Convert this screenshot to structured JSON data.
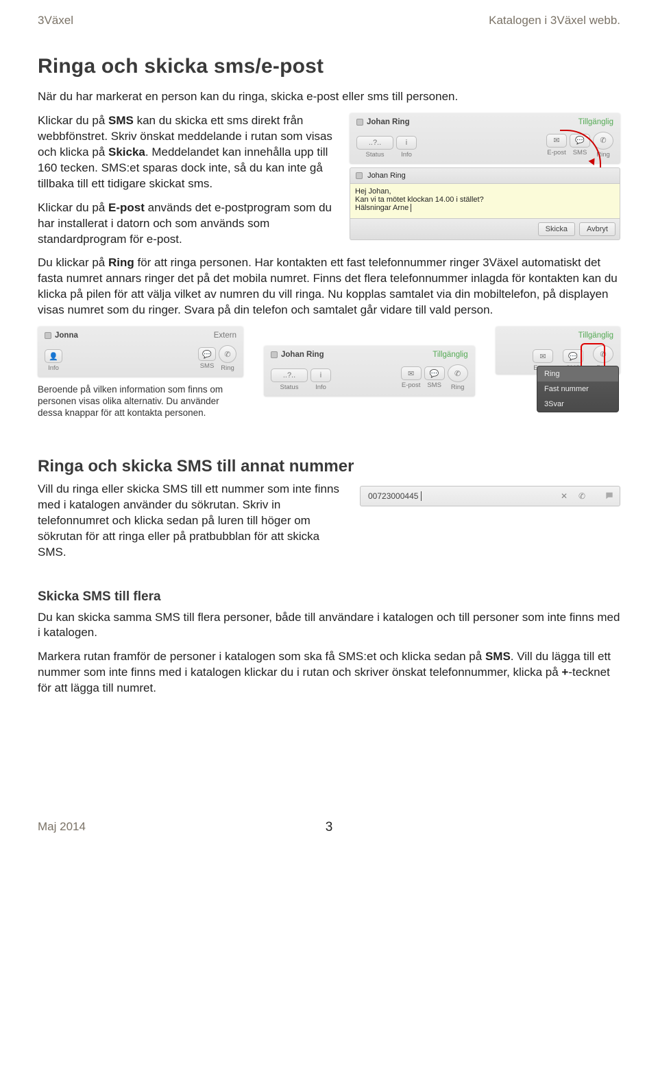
{
  "header": {
    "left": "3Växel",
    "right": "Katalogen i 3Växel webb."
  },
  "title": "Ringa och skicka sms/e-post",
  "intro": "När du har markerat en person kan du ringa, skicka e-post eller sms till personen.",
  "p_sms": {
    "pre": "Klickar du på ",
    "b": "SMS",
    "mid": " kan du skicka ett sms direkt från webbfönstret. Skriv önskat meddelande i rutan som visas och klicka på ",
    "b2": "Skicka",
    "post": ". Meddelandet kan innehålla upp till 160 tecken. SMS:et sparas dock inte, så du kan inte gå tillbaka till ett tidigare skickat sms."
  },
  "p_epost": {
    "pre": "Klickar du på ",
    "b": "E-post",
    "post": " används det e-postprogram som du har installerat i datorn och som används som standardprogram för e-post."
  },
  "p_ring": {
    "pre": "Du klickar på ",
    "b": "Ring",
    "post": " för att ringa personen. Har kontakten ett fast telefonnummer ringer 3Växel automatiskt det fasta numret annars ringer det på det mobila numret. Finns det flera telefon­nummer inlagda för kontakten kan du klicka på pilen för att välja vilket av numren du vill ringa. Nu kopplas samtalet via din mobiltelefon, på displayen visas numret som du ringer. Svara på din telefon och samtalet går vidare till vald person."
  },
  "caption_vary": "Beroende på vilken information som finns om personen visas olika alternativ. Du använder dessa knappar för att kontakta personen.",
  "h2_annat": "Ringa och skicka SMS till annat nummer",
  "p_annat": "Vill du ringa eller skicka SMS till ett nummer som inte finns med i katalogen använder du sökrutan. Skriv in telefonnumret och klicka sedan på luren till höger om sökrutan för att ringa eller på prat­bubblan för att skicka SMS.",
  "h3_flera": "Skicka SMS till flera",
  "p_flera1": "Du kan skicka samma SMS till flera personer, både till användare i katalogen och till personer som inte finns med i katalogen.",
  "p_flera2": {
    "pre": "Markera rutan framför de personer i katalogen som ska få SMS:et och klicka sedan på ",
    "b1": "SMS",
    "mid": ". Vill du lägga till ett nummer som inte finns med i katalogen klickar du i rutan och skriver önskat telefonnummer, klicka på ",
    "b2": "+",
    "post": "-tecknet för att lägga till numret."
  },
  "card1": {
    "name": "Johan Ring",
    "status": "Tillgänglig",
    "icons": {
      "status": "Status",
      "info": "Info",
      "epost": "E-post",
      "sms": "SMS",
      "ring": "Ring",
      "qmark": "..?.."
    }
  },
  "sms": {
    "to": "Johan Ring",
    "line1": "Hej Johan,",
    "line2": "Kan vi ta mötet klockan 14.00 i stället?",
    "line3": "Hälsningar Arne",
    "send": "Skicka",
    "cancel": "Avbryt"
  },
  "card_jonna": {
    "name": "Jonna",
    "status": "Extern",
    "icons": {
      "info": "Info",
      "sms": "SMS",
      "ring": "Ring"
    }
  },
  "card_wide": {
    "name": "Johan Ring",
    "status": "Tillgänglig",
    "icons": {
      "status": "Status",
      "info": "Info",
      "epost": "E-post",
      "sms": "SMS",
      "ring": "Ring",
      "qmark": "..?.."
    }
  },
  "card_menu": {
    "status": "Tillgänglig",
    "icons": {
      "epost": "E-post",
      "sms": "SMS",
      "ring": "Ring"
    },
    "menu": {
      "sel": "Ring",
      "opt1": "Fast nummer",
      "opt2": "3Svar"
    }
  },
  "search": {
    "value": "00723000445"
  },
  "footer": {
    "date": "Maj 2014",
    "page": "3"
  }
}
